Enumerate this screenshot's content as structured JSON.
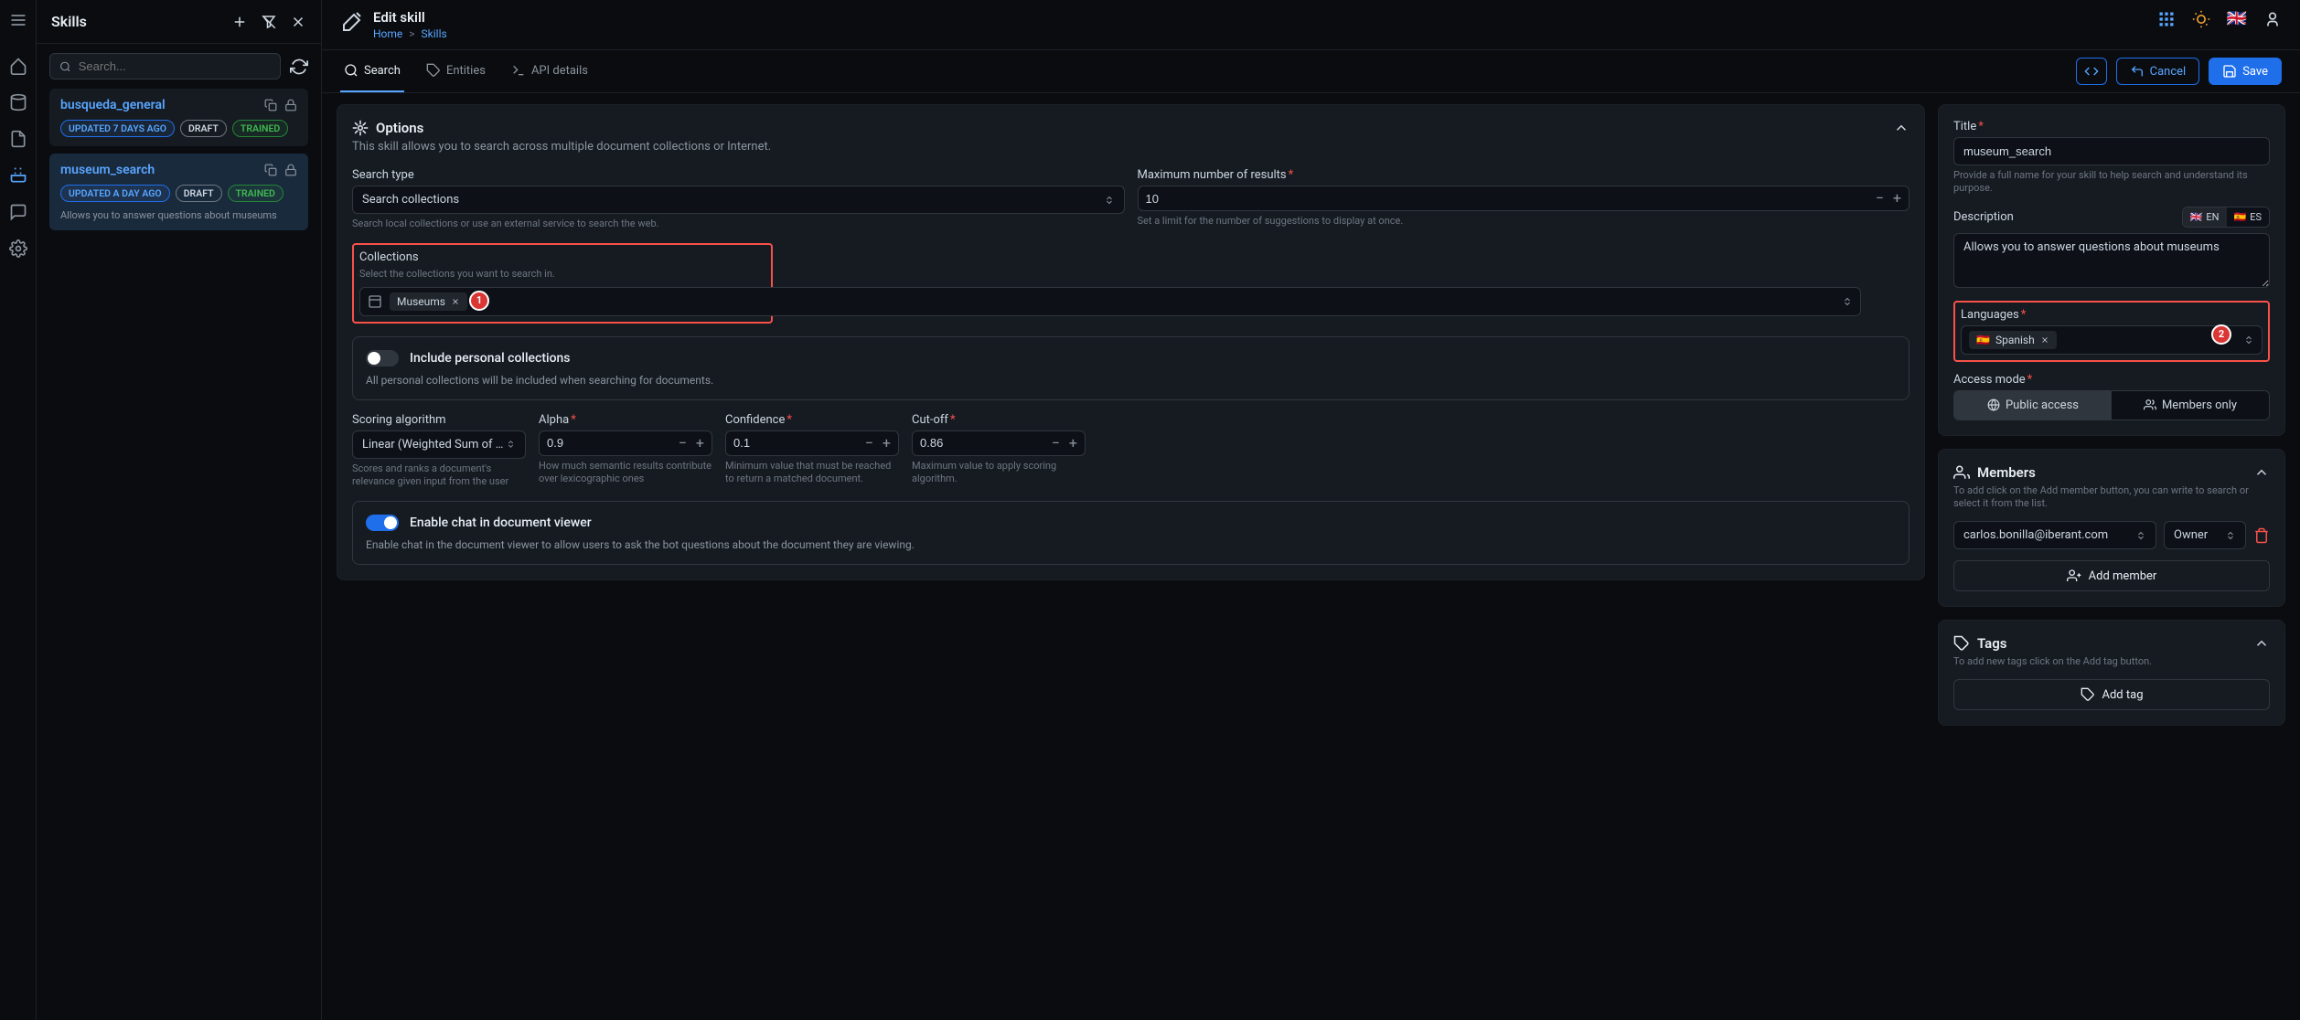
{
  "icon_rail": [
    "menu",
    "home",
    "database",
    "document",
    "wand",
    "chat",
    "settings"
  ],
  "sidebar": {
    "title": "Skills",
    "search_placeholder": "Search...",
    "items": [
      {
        "name": "busqueda_general",
        "updated": "UPDATED 7 DAYS AGO",
        "draft": "DRAFT",
        "trained": "TRAINED",
        "desc": ""
      },
      {
        "name": "museum_search",
        "updated": "UPDATED A DAY AGO",
        "draft": "DRAFT",
        "trained": "TRAINED",
        "desc": "Allows you to answer questions about museums"
      }
    ]
  },
  "header": {
    "title": "Edit skill",
    "breadcrumb": {
      "home": "Home",
      "skills": "Skills"
    }
  },
  "tabs": {
    "search": "Search",
    "entities": "Entities",
    "api": "API details"
  },
  "actions": {
    "cancel": "Cancel",
    "save": "Save"
  },
  "options": {
    "title": "Options",
    "subtitle": "This skill allows you to search across multiple document collections or Internet.",
    "search_type": {
      "label": "Search type",
      "value": "Search collections",
      "hint": "Search local collections or use an external service to search the web."
    },
    "max_results": {
      "label": "Maximum number of results",
      "value": "10",
      "hint": "Set a limit for the number of suggestions to display at once."
    },
    "collections": {
      "label": "Collections",
      "hint": "Select the collections you want to search in.",
      "chip": "Museums",
      "badge": "1"
    },
    "personal": {
      "title": "Include personal collections",
      "desc": "All personal collections will be included when searching for documents."
    },
    "scoring": {
      "label": "Scoring algorithm",
      "value": "Linear (Weighted Sum of Scor",
      "hint": "Scores and ranks a document's relevance given input from the user"
    },
    "alpha": {
      "label": "Alpha",
      "value": "0.9",
      "hint": "How much semantic results contribute over lexicographic ones"
    },
    "confidence": {
      "label": "Confidence",
      "value": "0.1",
      "hint": "Minimum value that must be reached to return a matched document."
    },
    "cutoff": {
      "label": "Cut-off",
      "value": "0.86",
      "hint": "Maximum value to apply scoring algorithm."
    },
    "chat": {
      "title": "Enable chat in document viewer",
      "desc": "Enable chat in the document viewer to allow users to ask the bot questions about the document they are viewing."
    }
  },
  "meta": {
    "title": {
      "label": "Title",
      "value": "museum_search",
      "hint": "Provide a full name for your skill to help search and understand its purpose."
    },
    "desc": {
      "label": "Description",
      "value": "Allows you to answer questions about museums",
      "en": "EN",
      "es": "ES"
    },
    "languages": {
      "label": "Languages",
      "chip": "Spanish",
      "badge": "2"
    },
    "access": {
      "label": "Access mode",
      "public": "Public access",
      "members": "Members only"
    }
  },
  "members": {
    "title": "Members",
    "hint": "To add click on the Add member button, you can write to search or select it from the list.",
    "email": "carlos.bonilla@iberant.com",
    "role": "Owner",
    "add": "Add member"
  },
  "tags": {
    "title": "Tags",
    "hint": "To add new tags click on the Add tag button.",
    "add": "Add tag"
  }
}
